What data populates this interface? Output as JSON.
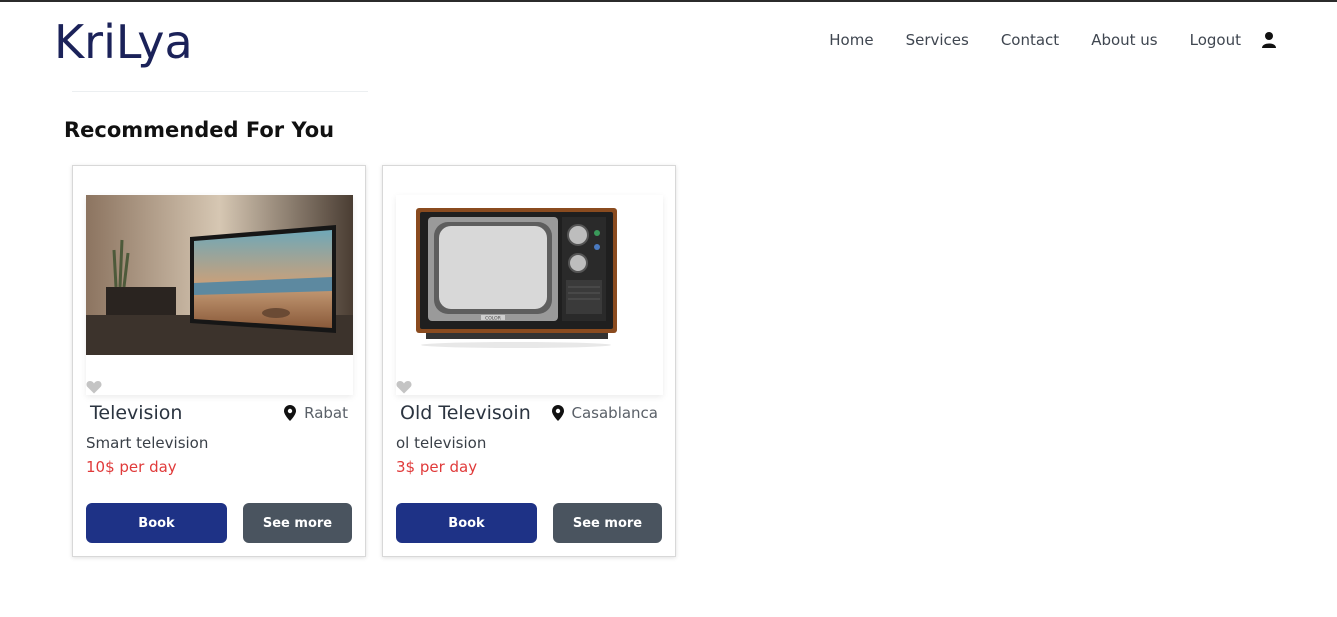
{
  "header": {
    "logo_text": "KriLya",
    "nav": [
      "Home",
      "Services",
      "Contact",
      "About us",
      "Logout"
    ]
  },
  "section": {
    "title": "Recommended For You"
  },
  "cards": [
    {
      "title": "Television",
      "location": "Rabat",
      "description": "Smart television",
      "price": "10$ per day",
      "book_label": "Book",
      "more_label": "See more"
    },
    {
      "title": "Old Televisoin",
      "location": "Casablanca",
      "description": "ol television",
      "price": "3$ per day",
      "book_label": "Book",
      "more_label": "See more",
      "tv_brand": "COLOR"
    }
  ],
  "colors": {
    "brand": "#1b2259",
    "book_button": "#1e3286",
    "more_button": "#4a545f",
    "price": "#e03a3a"
  },
  "icons": {
    "user": "user-icon",
    "heart": "heart-icon",
    "pin": "location-pin-icon"
  }
}
